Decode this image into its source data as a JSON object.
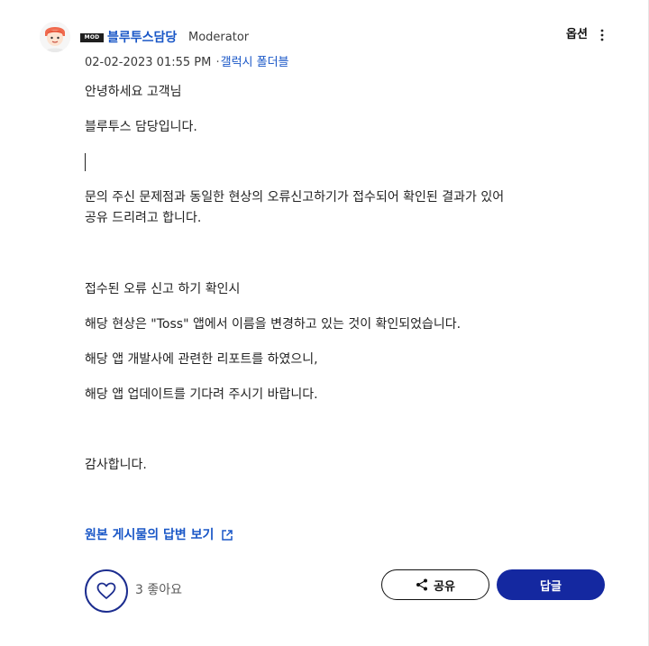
{
  "post": {
    "author": {
      "badge": "MOD",
      "name": "블루투스담당",
      "role": "Moderator"
    },
    "options_label": "옵션",
    "date": "02-02-2023 01:55 PM",
    "separator": "·",
    "board": "갤럭시 폴더블",
    "body": [
      "안녕하세요 고객님",
      "블루투스 담당입니다.",
      "문의 주신 문제점과 동일한 현상의 오류신고하기가 접수되어 확인된 결과가 있어",
      "공유 드리려고 합니다.",
      "접수된 오류 신고 하기 확인시",
      "해당 현상은 \"Toss\" 앱에서 이름을 변경하고 있는 것이 확인되었습니다.",
      "해당 앱 개발사에 관련한 리포트를 하였으니,",
      "해당 앱 업데이트를 기다려 주시기 바랍니다.",
      "감사합니다."
    ],
    "view_original_label": "원본 게시물의 답변 보기",
    "like_count_label": "3 좋아요",
    "share_label": "공유",
    "reply_label": "답글"
  },
  "colors": {
    "link": "#1a57c7",
    "primary_button": "#1428a0",
    "like_border": "#1c2d8f"
  },
  "icons": {
    "options": "kebab-menu-icon",
    "external": "external-link-icon",
    "like": "heart-icon",
    "share": "share-icon"
  }
}
